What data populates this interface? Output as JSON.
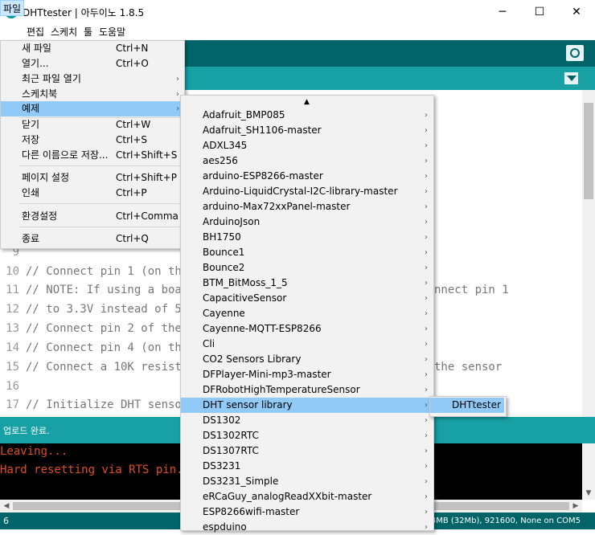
{
  "window": {
    "title": "DHTtester | 아두이노 1.8.5",
    "controls": {
      "minimize": "─",
      "maximize": "☐",
      "close": "✕"
    }
  },
  "menubar": [
    "파일",
    "편집",
    "스케치",
    "툴",
    "도움말"
  ],
  "file_menu": {
    "items": [
      {
        "label": "새 파일",
        "shortcut": "Ctrl+N",
        "submenu": false
      },
      {
        "label": "열기...",
        "shortcut": "Ctrl+O",
        "submenu": false
      },
      {
        "label": "최근 파일 열기",
        "shortcut": "",
        "submenu": true
      },
      {
        "label": "스케치북",
        "shortcut": "",
        "submenu": true
      },
      {
        "label": "예제",
        "shortcut": "",
        "submenu": true,
        "highlighted": true
      },
      {
        "label": "닫기",
        "shortcut": "Ctrl+W",
        "submenu": false
      },
      {
        "label": "저장",
        "shortcut": "Ctrl+S",
        "submenu": false
      },
      {
        "label": "다른 이름으로 저장...",
        "shortcut": "Ctrl+Shift+S",
        "submenu": false
      },
      {
        "label": "페이지 설정",
        "shortcut": "Ctrl+Shift+P",
        "submenu": false
      },
      {
        "label": "인쇄",
        "shortcut": "Ctrl+P",
        "submenu": false
      },
      {
        "label": "환경설정",
        "shortcut": "Ctrl+Comma",
        "submenu": false
      },
      {
        "label": "종료",
        "shortcut": "Ctrl+Q",
        "submenu": false
      }
    ]
  },
  "examples_menu": {
    "scroll_up": "▲",
    "items": [
      "Adafruit_BMP085",
      "Adafruit_SH1106-master",
      "ADXL345",
      "aes256",
      "arduino-ESP8266-master",
      "Arduino-LiquidCrystal-I2C-library-master",
      "arduino-Max72xxPanel-master",
      "ArduinoJson",
      "BH1750",
      "Bounce1",
      "Bounce2",
      "BTM_BitMoss_1_5",
      "CapacitiveSensor",
      "Cayenne",
      "Cayenne-MQTT-ESP8266",
      "Cli",
      "CO2 Sensors Library",
      "DFPlayer-Mini-mp3-master",
      "DFRobotHighTemperatureSensor",
      "DHT sensor library",
      "DS1302",
      "DS1302RTC",
      "DS1307RTC",
      "DS3231",
      "DS3231_Simple",
      "eRCaGuy_analogReadXXbit-master",
      "ESP8266wifi-master",
      "espduino"
    ],
    "highlighted": "DHT sensor library",
    "arrow": "›"
  },
  "dht_submenu": {
    "items": [
      "DHTtester"
    ]
  },
  "editor": {
    "lines": [
      {
        "num": "9",
        "text": ""
      },
      {
        "num": "10",
        "text": "// Connect pin 1 (on the"
      },
      {
        "num": "11",
        "text": "// NOTE: If using a boar"
      },
      {
        "num": "12",
        "text": "// to 3.3V instead of 5V"
      },
      {
        "num": "13",
        "text": "// Connect pin 2 of the"
      },
      {
        "num": "14",
        "text": "// Connect pin 4 (on the"
      },
      {
        "num": "15",
        "text": "// Connect a 10K resisto"
      },
      {
        "num": "16",
        "text": ""
      },
      {
        "num": "17",
        "text": "// Initialize DHT sensor"
      }
    ],
    "right_fragments": {
      "line11": "nnect pin 1",
      "line15": "the sensor"
    }
  },
  "status": {
    "message": "업로드 완료."
  },
  "console": {
    "lines": [
      "Leaving...",
      "Hard resetting via RTS pin..."
    ]
  },
  "footer": {
    "line_number": "6",
    "board_info": "MHz, 4MB (32Mb), 921600, None on COM5"
  },
  "colors": {
    "toolbar": "#006468",
    "tabbar": "#17a1a5",
    "highlight": "#91c9f7",
    "console_text": "#e34c22"
  }
}
